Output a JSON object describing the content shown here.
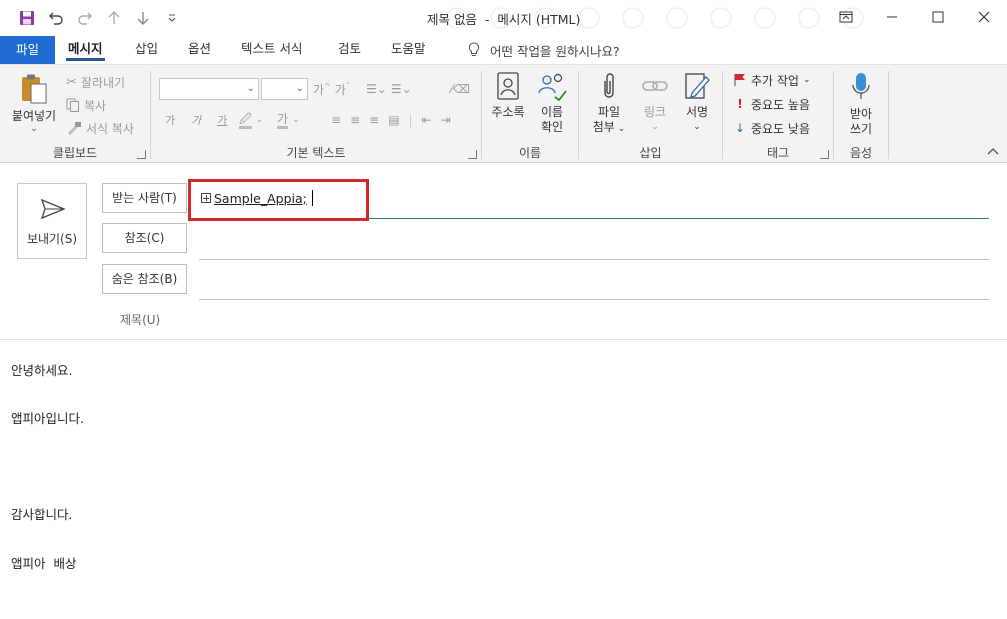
{
  "window": {
    "title": "제목 없음  -  메시지 (HTML)"
  },
  "qat": {
    "save_icon": "save-icon",
    "undo_icon": "undo-icon",
    "redo_icon": "redo-icon",
    "up_icon": "arrow-up-icon",
    "down_icon": "arrow-down-icon",
    "customize_icon": "customize-qat-icon"
  },
  "tabs": [
    {
      "label": "파일"
    },
    {
      "label": "메시지"
    },
    {
      "label": "삽입"
    },
    {
      "label": "옵션"
    },
    {
      "label": "텍스트 서식"
    },
    {
      "label": "검토"
    },
    {
      "label": "도움말"
    }
  ],
  "tell_me": "어떤 작업을 원하시나요?",
  "ribbon": {
    "clipboard": {
      "paste": "붙여넣기",
      "cut": "잘라내기",
      "copy": "복사",
      "format_painter": "서식 복사",
      "group": "클립보드"
    },
    "basic_text": {
      "group": "기본 텍스트",
      "bold": "가",
      "italic": "가",
      "underline": "가"
    },
    "names": {
      "address_book": "주소록",
      "check_names_1": "이름",
      "check_names_2": "확인",
      "group": "이름"
    },
    "insert": {
      "attach_1": "파일",
      "attach_2": "첨부",
      "link": "링크",
      "signature": "서명",
      "group": "삽입"
    },
    "tags": {
      "follow_up": "추가 작업",
      "high": "중요도 높음",
      "low": "중요도 낮음",
      "group": "태그"
    },
    "voice": {
      "dictate_1": "받아",
      "dictate_2": "쓰기",
      "group": "음성"
    }
  },
  "compose": {
    "send": "보내기(S)",
    "to_button": "받는 사람(T)",
    "cc_button": "참조(C)",
    "bcc_button": "숨은 참조(B)",
    "subject_label": "제목(U)",
    "to_value": "Sample_Appia;"
  },
  "body": {
    "lines": [
      "안녕하세요.",
      "앱피아입니다.",
      "감사합니다.",
      "앱피아  배상"
    ]
  },
  "colors": {
    "file_tab": "#1f6bd1",
    "highlight": "#d6262e",
    "focus_line": "#2f7f7b"
  }
}
